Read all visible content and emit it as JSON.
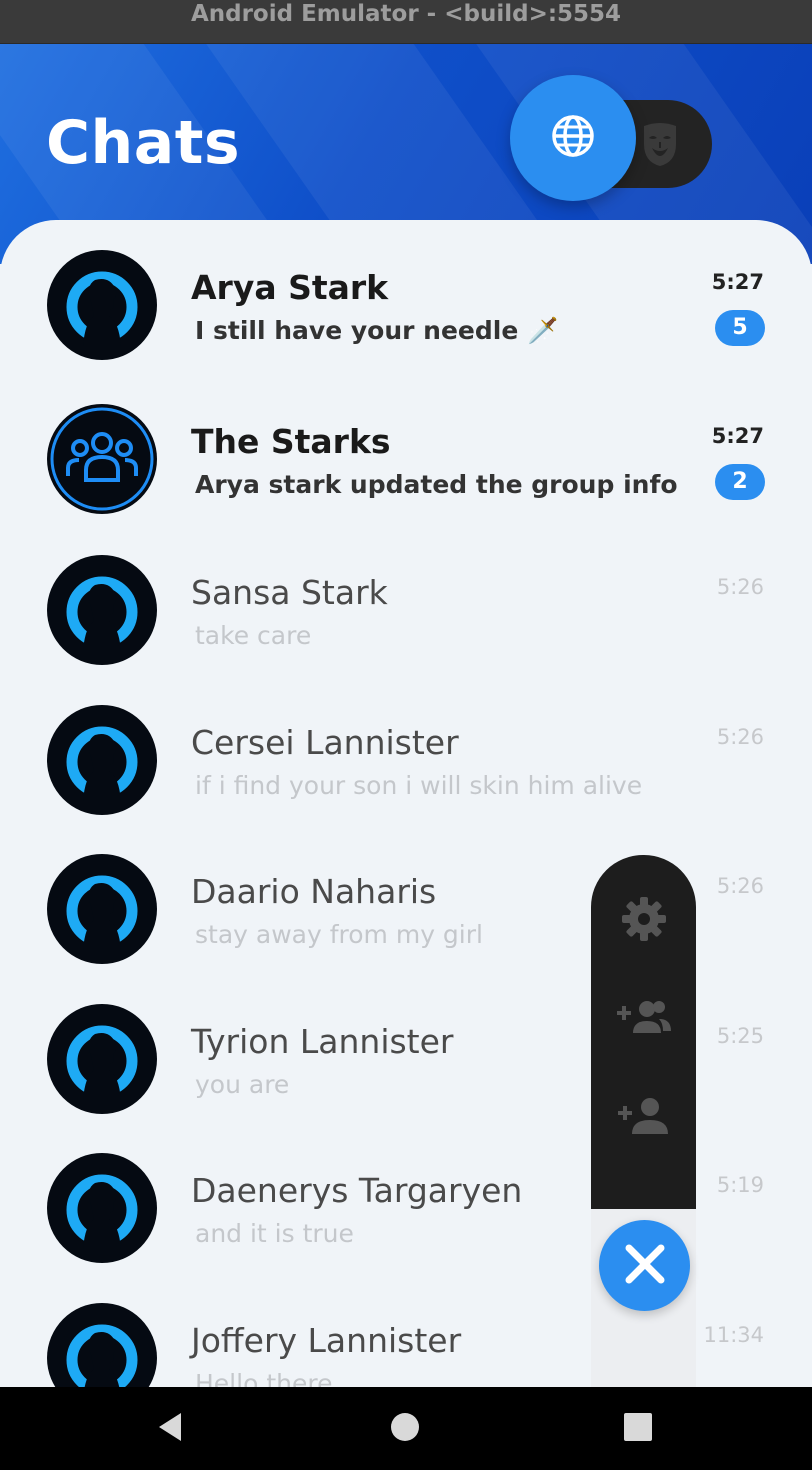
{
  "window": {
    "title": "Android Emulator - <build>:5554"
  },
  "header": {
    "title": "Chats",
    "toggle_active_icon": "globe-icon",
    "toggle_inactive_icon": "anonymous-mask-icon"
  },
  "chats": [
    {
      "name": "Arya Stark",
      "message": "I still have your needle 🗡️",
      "time": "5:27",
      "unread": "5",
      "is_unread": true,
      "avatar": "person-silhouette"
    },
    {
      "name": "The Starks",
      "message": "Arya stark updated the group info",
      "time": "5:27",
      "unread": "2",
      "is_unread": true,
      "avatar": "group-icon"
    },
    {
      "name": "Sansa Stark",
      "message": "take care",
      "time": "5:26",
      "is_unread": false,
      "avatar": "person-silhouette"
    },
    {
      "name": "Cersei Lannister",
      "message": "if i find your son i will skin him alive",
      "time": "5:26",
      "is_unread": false,
      "avatar": "person-silhouette"
    },
    {
      "name": "Daario Naharis",
      "message": "stay away from my girl",
      "time": "5:26",
      "is_unread": false,
      "avatar": "person-silhouette"
    },
    {
      "name": "Tyrion Lannister",
      "message": "you are",
      "time": "5:25",
      "is_unread": false,
      "avatar": "person-silhouette"
    },
    {
      "name": "Daenerys Targaryen",
      "message": "and it is true",
      "time": "5:19",
      "is_unread": false,
      "avatar": "person-silhouette"
    },
    {
      "name": "Joffery Lannister",
      "message": "Hello there",
      "time": "11:34",
      "is_unread": false,
      "avatar": "person-silhouette"
    }
  ],
  "fab": {
    "items": [
      "settings-icon",
      "add-group-icon",
      "add-person-icon"
    ],
    "close": "close-icon"
  },
  "navbar": {
    "buttons": [
      "back-icon",
      "home-icon",
      "recents-icon"
    ]
  },
  "colors": {
    "accent": "#2b8ef0",
    "header": "#1f6fe0",
    "dark": "#1d1d1d",
    "background": "#f0f4f8"
  }
}
